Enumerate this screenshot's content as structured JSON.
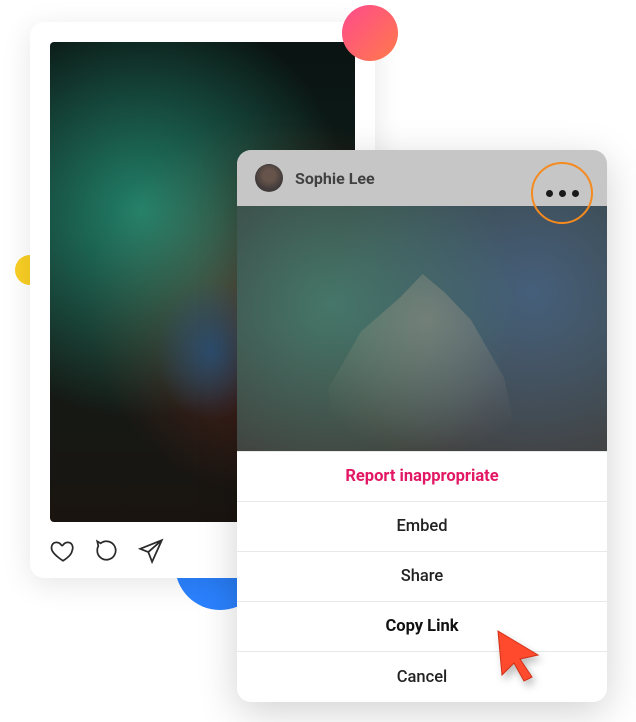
{
  "post_front": {
    "username": "Sophie Lee"
  },
  "menu": {
    "report": "Report inappropriate",
    "embed": "Embed",
    "share": "Share",
    "copy_link": "Copy Link",
    "cancel": "Cancel"
  },
  "icons": {
    "like": "heart-icon",
    "comment": "comment-icon",
    "send": "send-icon",
    "more": "more-icon"
  },
  "colors": {
    "accent_pink": "#e31864",
    "highlight_orange": "#f58a1f"
  }
}
